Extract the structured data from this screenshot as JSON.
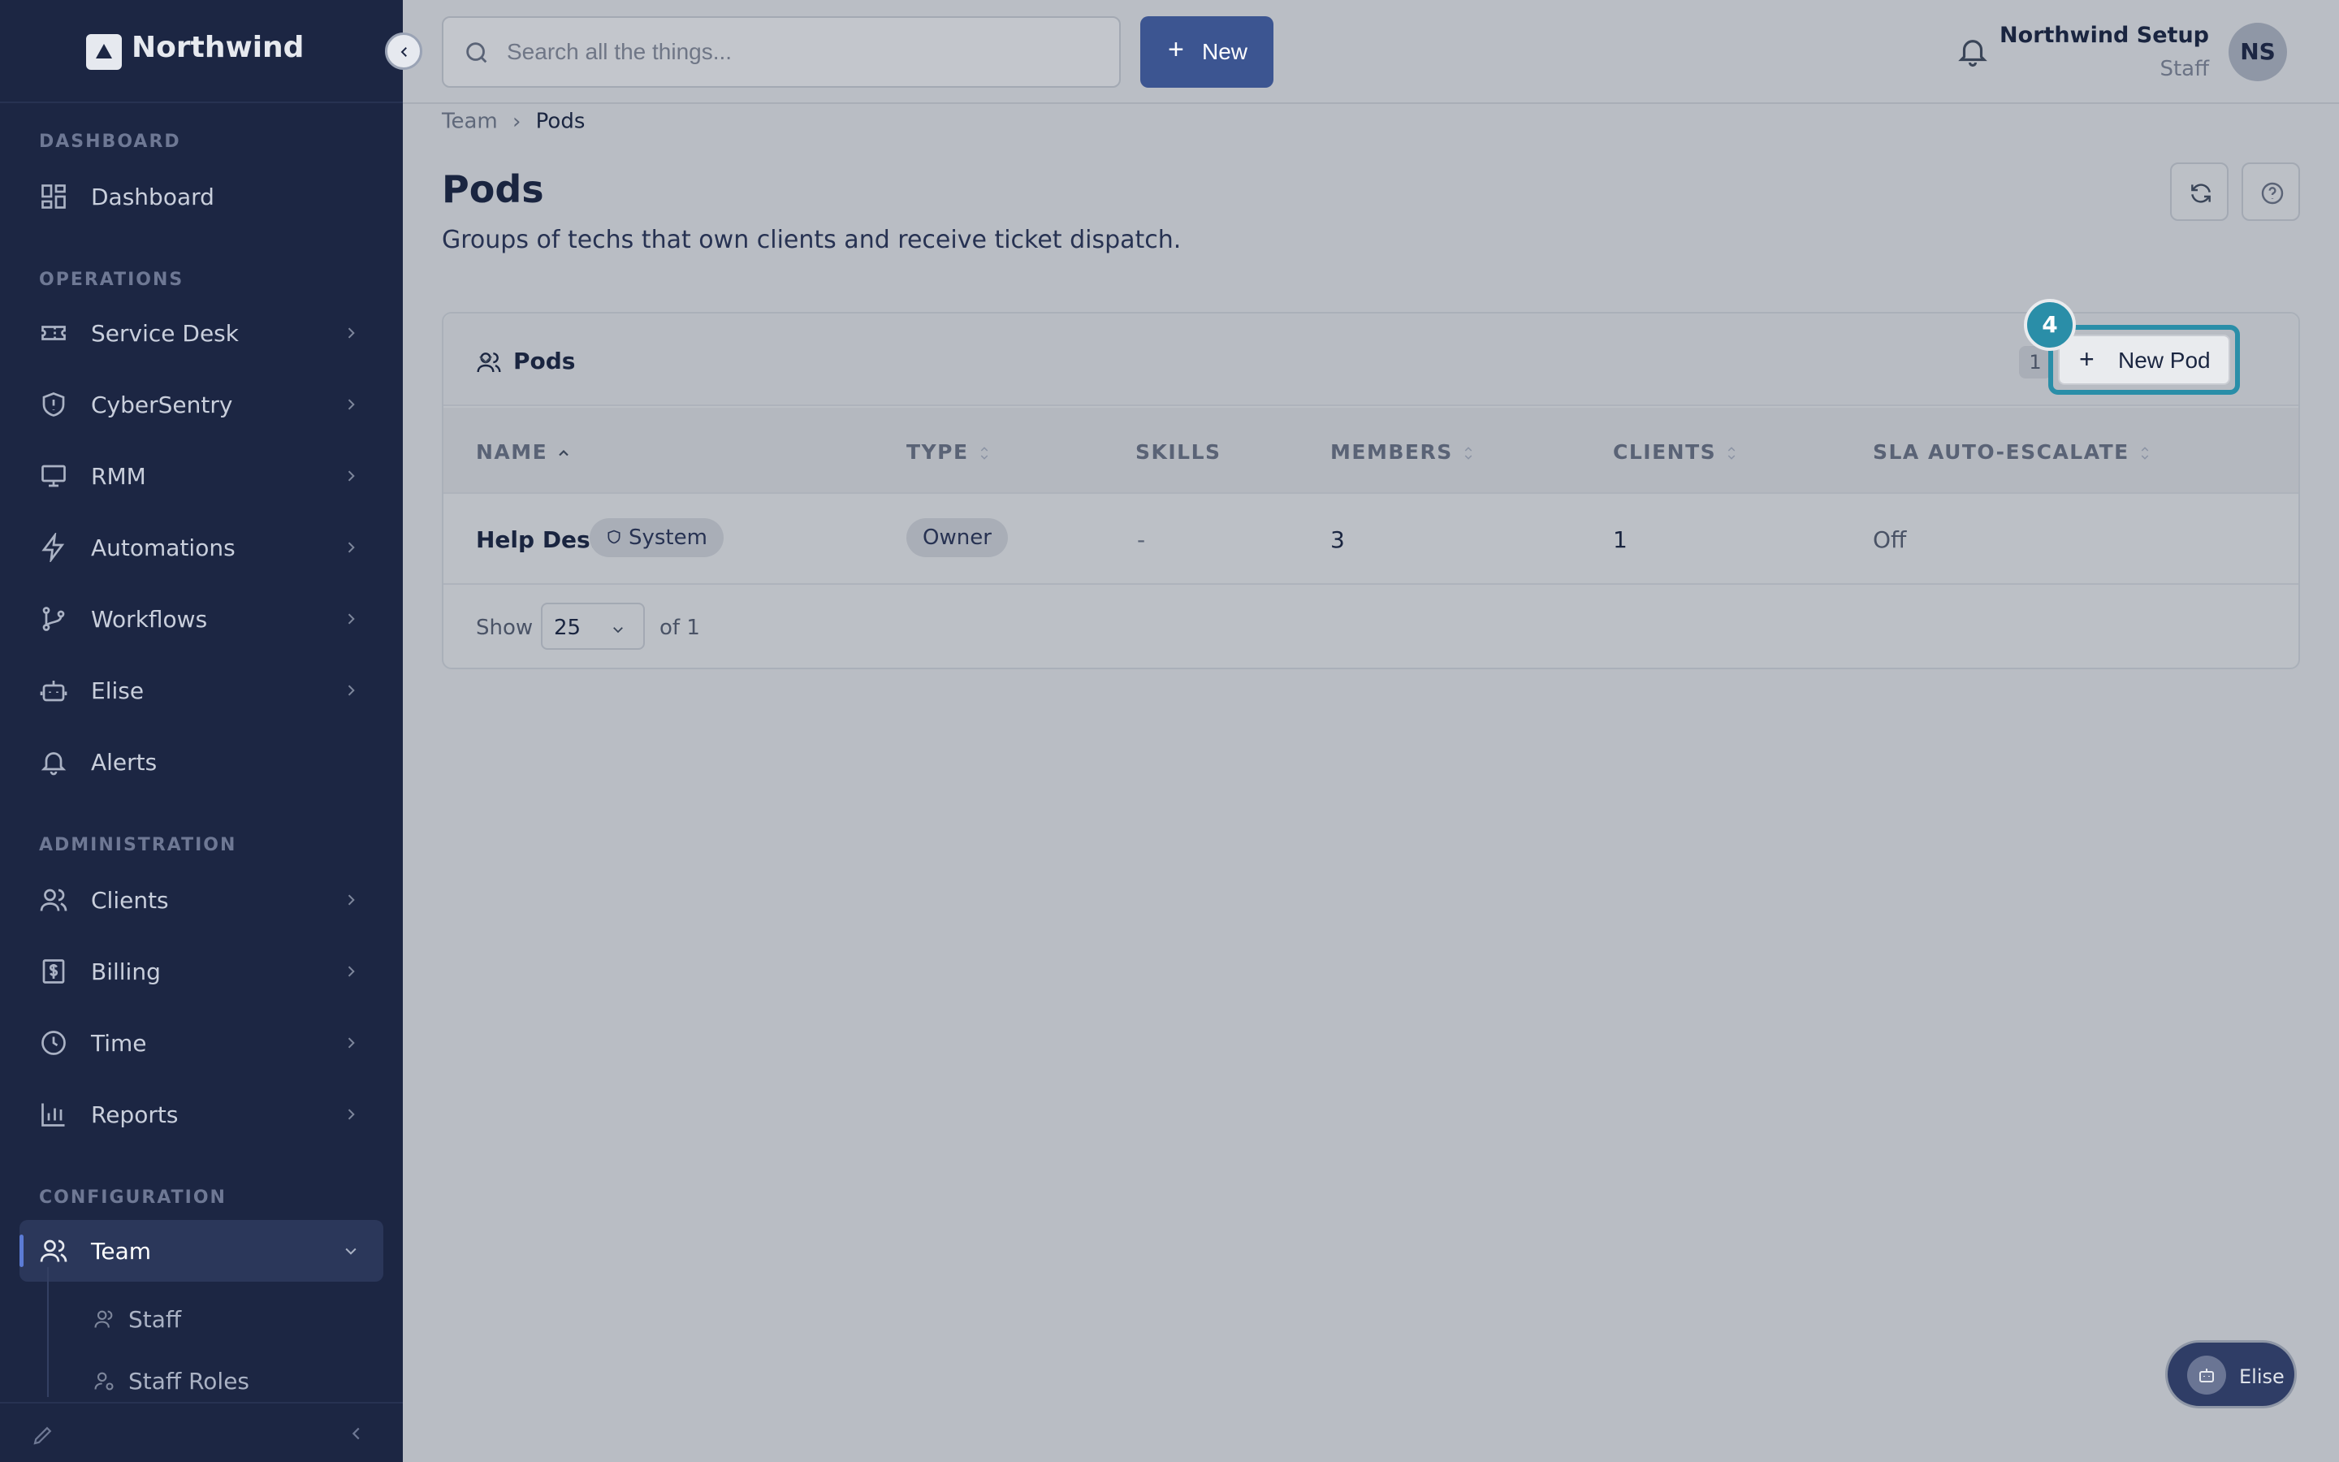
{
  "brand": {
    "name": "Northwind"
  },
  "sidebar": {
    "sections": {
      "dashboard": "DASHBOARD",
      "operations": "OPERATIONS",
      "administration": "ADMINISTRATION",
      "configuration": "CONFIGURATION"
    },
    "items": {
      "dashboard": "Dashboard",
      "service_desk": "Service Desk",
      "cybersentry": "CyberSentry",
      "rmm": "RMM",
      "automations": "Automations",
      "workflows": "Workflows",
      "elise": "Elise",
      "alerts": "Alerts",
      "clients": "Clients",
      "billing": "Billing",
      "time": "Time",
      "reports": "Reports",
      "team": "Team"
    },
    "team_sub": {
      "staff": "Staff",
      "staff_roles": "Staff Roles"
    }
  },
  "topbar": {
    "search_placeholder": "Search all the things...",
    "new_label": "New",
    "user_name": "Northwind Setup",
    "user_role": "Staff",
    "avatar_initials": "NS"
  },
  "breadcrumb": {
    "parent": "Team",
    "current": "Pods"
  },
  "page": {
    "title": "Pods",
    "subtitle": "Groups of techs that own clients and receive ticket dispatch."
  },
  "card": {
    "title": "Pods",
    "count": "1",
    "new_button": "New Pod",
    "step_number": "4",
    "columns": [
      "NAME",
      "TYPE",
      "SKILLS",
      "MEMBERS",
      "CLIENTS",
      "SLA AUTO-ESCALATE"
    ],
    "rows": [
      {
        "name": "Help Desk",
        "badge": "System",
        "type": "Owner",
        "skills": "-",
        "members": "3",
        "clients": "1",
        "sla": "Off"
      }
    ],
    "pager": {
      "show_label": "Show",
      "page_size": "25",
      "of_label": "of 1"
    }
  },
  "fab": {
    "label": "Elise"
  },
  "colors": {
    "sidebar": "#1c2643",
    "primary": "#3c5591",
    "highlight": "#2a8ea8"
  }
}
